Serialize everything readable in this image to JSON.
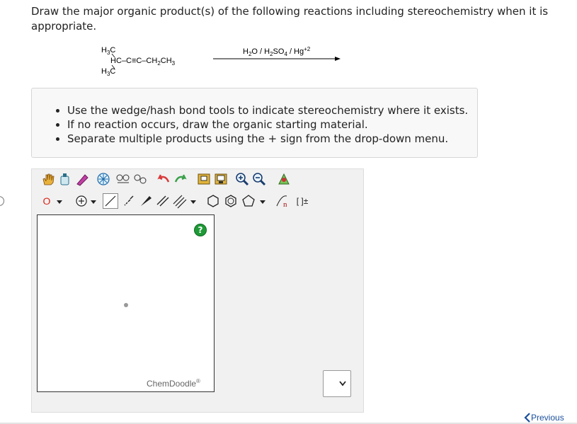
{
  "question": {
    "prompt": "Draw the major organic product(s) of the following reactions including stereochemistry when it is appropriate."
  },
  "reaction": {
    "reactant": {
      "top_group": "H3C",
      "main_chain": "HC-C≡C-CH2CH3",
      "bottom_group": "H3C"
    },
    "reagents": "H2O / H2SO4 / Hg+2"
  },
  "instructions": {
    "items": [
      "Use the wedge/hash bond tools to indicate stereochemistry where it exists.",
      "If no reaction occurs, draw the organic starting material.",
      "Separate multiple products using the + sign from the drop-down menu."
    ]
  },
  "editor": {
    "element_button": "O",
    "help_label": "?",
    "brand": "ChemDoodle",
    "brand_mark": "®",
    "toolbar_text_tools": [
      "n",
      "[ ]±"
    ]
  },
  "navigation": {
    "previous_label": "Previous"
  },
  "colors": {
    "accent_link": "#1a4f9c",
    "help_green": "#1f9a37",
    "element_red": "#d9261c"
  }
}
